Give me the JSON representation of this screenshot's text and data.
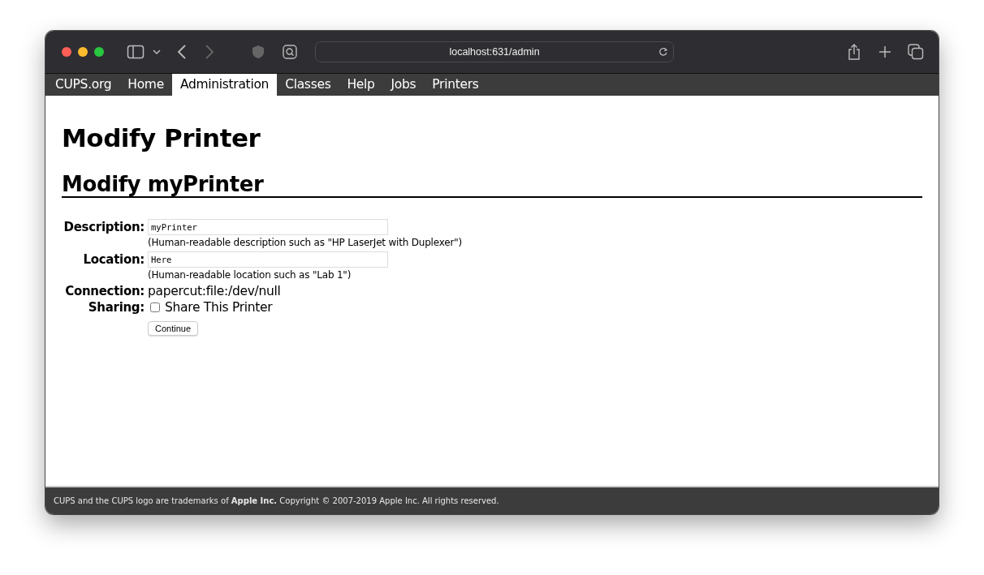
{
  "browser": {
    "address": "localhost:631/admin"
  },
  "nav": [
    {
      "label": "CUPS.org",
      "selected": false
    },
    {
      "label": "Home",
      "selected": false
    },
    {
      "label": "Administration",
      "selected": true
    },
    {
      "label": "Classes",
      "selected": false
    },
    {
      "label": "Help",
      "selected": false
    },
    {
      "label": "Jobs",
      "selected": false
    },
    {
      "label": "Printers",
      "selected": false
    }
  ],
  "page_title": "Modify Printer",
  "section_title": "Modify myPrinter",
  "form": {
    "description": {
      "label": "Description:",
      "value": "myPrinter",
      "hint": "(Human-readable description such as \"HP LaserJet with Duplexer\")"
    },
    "location": {
      "label": "Location:",
      "value": "Here",
      "hint": "(Human-readable location such as \"Lab 1\")"
    },
    "connection": {
      "label": "Connection:",
      "value": "papercut:file:/dev/null"
    },
    "sharing": {
      "label": "Sharing:",
      "option": "Share This Printer",
      "checked": false
    },
    "button": "Continue"
  },
  "footer": "CUPS and the CUPS logo are trademarks of **Apple Inc.** Copyright © 2007-2019 Apple Inc. All rights reserved."
}
